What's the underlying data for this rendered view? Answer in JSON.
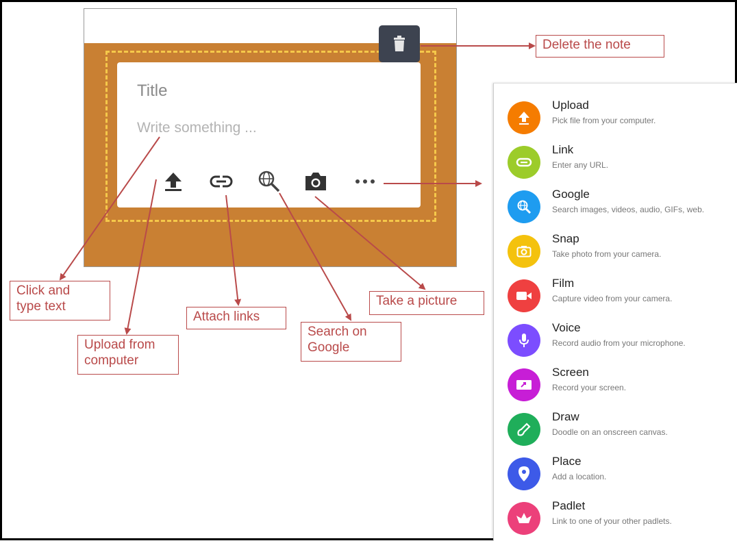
{
  "note": {
    "title_placeholder": "Title",
    "body_placeholder": "Write something ...",
    "toolbar": [
      "upload-icon",
      "link-icon",
      "search-web-icon",
      "camera-icon",
      "more-icon"
    ],
    "background_color": "#c98033",
    "delete_icon": "trash-icon"
  },
  "callouts": {
    "delete": "Delete the note",
    "click_type_line1": "Click and",
    "click_type_line2": "type  text",
    "upload_line1": "Upload from",
    "upload_line2": "computer",
    "attach": "Attach links",
    "search_line1": "Search on",
    "search_line2": "Google",
    "picture": "Take a picture"
  },
  "menu": {
    "items": [
      {
        "label": "Upload",
        "desc": "Pick file from your computer.",
        "color": "#f57c00",
        "icon": "upload-icon"
      },
      {
        "label": "Link",
        "desc": "Enter any URL.",
        "color": "#9ccc2a",
        "icon": "link-icon"
      },
      {
        "label": "Google",
        "desc": "Search images, videos, audio, GIFs, web.",
        "color": "#1e9cf0",
        "icon": "google-search-icon"
      },
      {
        "label": "Snap",
        "desc": "Take photo from your camera.",
        "color": "#f4c20d",
        "icon": "camera-icon"
      },
      {
        "label": "Film",
        "desc": "Capture video from your camera.",
        "color": "#ef4040",
        "icon": "video-icon"
      },
      {
        "label": "Voice",
        "desc": "Record audio from your microphone.",
        "color": "#7c4dff",
        "icon": "microphone-icon"
      },
      {
        "label": "Screen",
        "desc": "Record your screen.",
        "color": "#c71ed6",
        "icon": "screen-icon"
      },
      {
        "label": "Draw",
        "desc": "Doodle on an onscreen canvas.",
        "color": "#1fae5a",
        "icon": "pen-icon"
      },
      {
        "label": "Place",
        "desc": "Add a location.",
        "color": "#3d5ae8",
        "icon": "location-pin-icon"
      },
      {
        "label": "Padlet",
        "desc": "Link to one of your other padlets.",
        "color": "#ec407a",
        "icon": "padlet-icon"
      }
    ]
  },
  "annotation_color": "#b94a4a"
}
